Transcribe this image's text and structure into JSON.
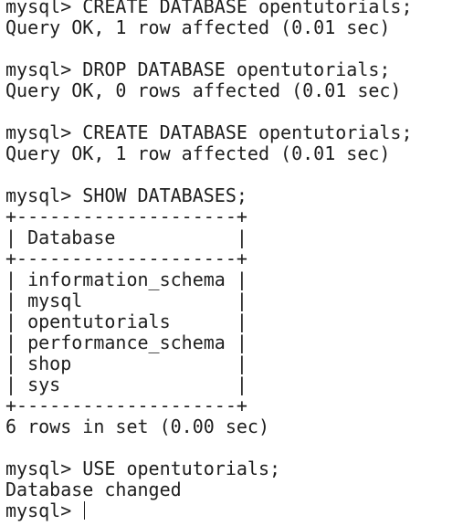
{
  "terminal": {
    "lines": [
      "mysql> CREATE DATABASE opentutorials;",
      "Query OK, 1 row affected (0.01 sec)",
      "",
      "mysql> DROP DATABASE opentutorials;",
      "Query OK, 0 rows affected (0.01 sec)",
      "",
      "mysql> CREATE DATABASE opentutorials;",
      "Query OK, 1 row affected (0.01 sec)",
      "",
      "mysql> SHOW DATABASES;",
      "+--------------------+",
      "| Database           |",
      "+--------------------+",
      "| information_schema |",
      "| mysql              |",
      "| opentutorials      |",
      "| performance_schema |",
      "| shop               |",
      "| sys                |",
      "+--------------------+",
      "6 rows in set (0.00 sec)",
      "",
      "mysql> USE opentutorials;",
      "Database changed"
    ],
    "prompt": "mysql> "
  }
}
